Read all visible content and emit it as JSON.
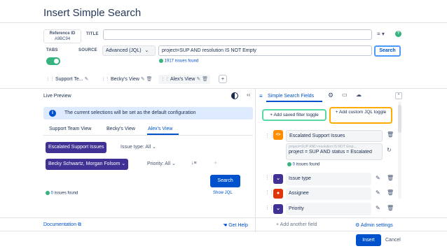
{
  "dialog": {
    "title": "Insert Simple Search"
  },
  "form": {
    "reference": {
      "label": "Reference ID",
      "value": "A9BC94"
    },
    "title_label": "TITLE",
    "title_value": "",
    "tabs_label": "TABS",
    "source_label": "SOURCE",
    "source_select": "Advanced (JQL)",
    "jql_value": "project=SUP AND resolution IS NOT Empty",
    "search_button": "Search",
    "issues_found": "1917 issues found"
  },
  "view_tabs": [
    {
      "label": "Support Te..."
    },
    {
      "label": "Becky's View"
    },
    {
      "label": "Alex's View"
    }
  ],
  "add_tab": "+",
  "live_preview": {
    "title": "Live Preview",
    "info": "The current selections will be set as the default configuration",
    "subtabs": [
      "Support Team View",
      "Becky's View",
      "Alex's View"
    ],
    "filters": {
      "saved_filter": "Escalated Support Issues",
      "issue_type": "Issue type: All",
      "assignee": "Becky Schwartz, Morgan Folsom",
      "priority": "Priority: All"
    },
    "search_button": "Search",
    "issues_count": "0",
    "issues_suffix": "issues found",
    "show_jql": "Show JQL"
  },
  "fields_panel": {
    "title": "Simple Search Fields",
    "add_saved_filter": "+ Add saved filter toggle",
    "add_custom_jql": "+ Add custom JQL toggle",
    "escalated": {
      "name": "Escalated Support Issues",
      "jql_placeholder": "project=SUP AND resolution IS NOT Emp...",
      "jql_value": "project = SUP AND status = Escalated",
      "count": "0",
      "count_suffix": "issues found"
    },
    "fields": [
      {
        "name": "Issue type",
        "color": "#403294"
      },
      {
        "name": "Assignee",
        "color": "#de350b"
      },
      {
        "name": "Priority",
        "color": "#403294"
      }
    ],
    "add_another": "+ Add another field",
    "admin_settings": "Admin settings"
  },
  "footer": {
    "documentation": "Documentation",
    "get_help": "Get Help",
    "insert": "Insert",
    "cancel": "Cancel"
  },
  "colors": {
    "primary": "#0052cc",
    "success": "#36b37e",
    "purple": "#403294"
  }
}
